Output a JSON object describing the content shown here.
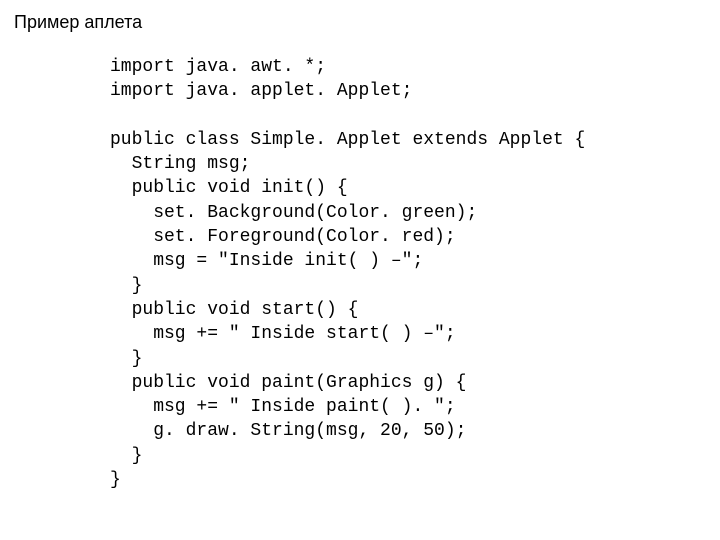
{
  "title": "Пример аплета",
  "code": "import java. awt. *;\nimport java. applet. Applet;\n\npublic class Simple. Applet extends Applet {\n  String msg;\n  public void init() {\n    set. Background(Color. green);\n    set. Foreground(Color. red);\n    msg = \"Inside init( ) –\";\n  }\n  public void start() {\n    msg += \" Inside start( ) –\";\n  }\n  public void paint(Graphics g) {\n    msg += \" Inside paint( ). \";\n    g. draw. String(msg, 20, 50);\n  }\n}"
}
